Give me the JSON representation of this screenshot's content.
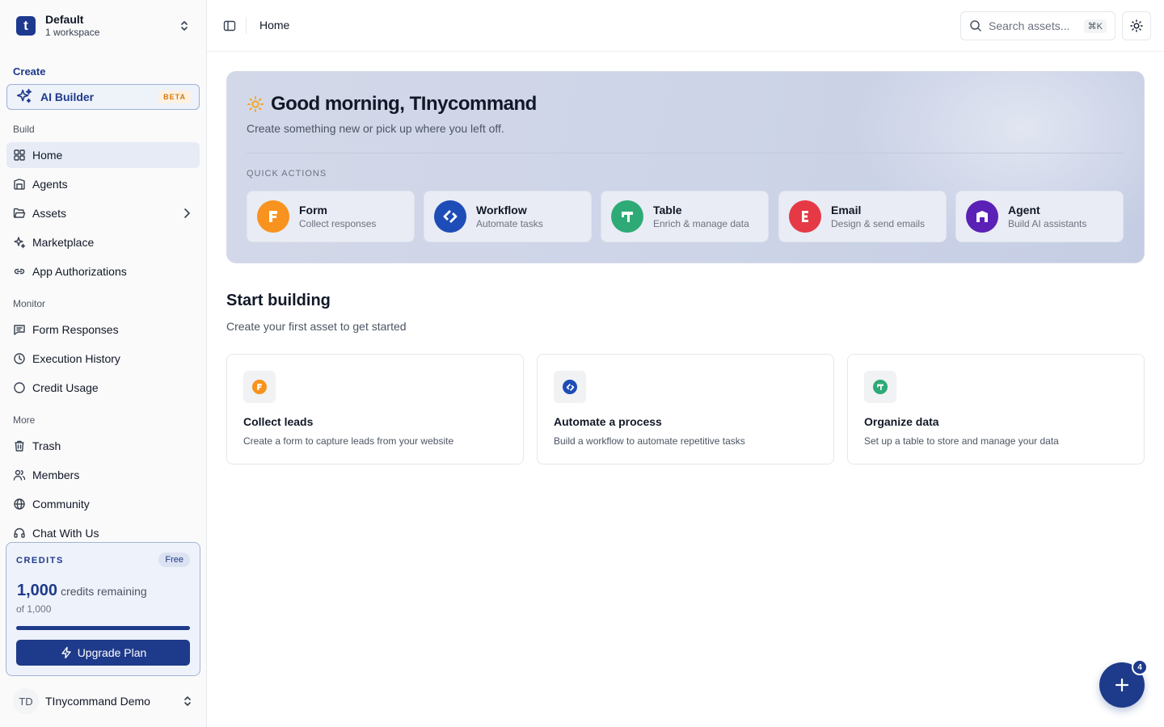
{
  "workspace": {
    "name": "Default",
    "sub": "1 workspace",
    "logo_letter": "t"
  },
  "sidebar": {
    "create_label": "Create",
    "ai_builder": {
      "label": "AI Builder",
      "badge": "BETA"
    },
    "build_label": "Build",
    "build_items": [
      {
        "label": "Home",
        "icon": "grid-icon"
      },
      {
        "label": "Agents",
        "icon": "agent-icon"
      },
      {
        "label": "Assets",
        "icon": "folder-icon"
      },
      {
        "label": "Marketplace",
        "icon": "sparkle-icon"
      },
      {
        "label": "App Authorizations",
        "icon": "link-icon"
      }
    ],
    "monitor_label": "Monitor",
    "monitor_items": [
      {
        "label": "Form Responses",
        "icon": "message-icon"
      },
      {
        "label": "Execution History",
        "icon": "clock-icon"
      },
      {
        "label": "Credit Usage",
        "icon": "circle-icon"
      }
    ],
    "more_label": "More",
    "more_items": [
      {
        "label": "Trash",
        "icon": "trash-icon"
      },
      {
        "label": "Members",
        "icon": "users-icon"
      },
      {
        "label": "Community",
        "icon": "globe-icon"
      },
      {
        "label": "Chat With Us",
        "icon": "headset-icon"
      }
    ]
  },
  "credits": {
    "header": "CREDITS",
    "plan": "Free",
    "remaining": "1,000",
    "remaining_label": "credits remaining",
    "total": "of 1,000",
    "fraction_remaining": 1.0,
    "upgrade_label": "Upgrade Plan"
  },
  "user": {
    "initials": "TD",
    "name": "TInycommand Demo"
  },
  "topbar": {
    "breadcrumb": "Home",
    "search_placeholder": "Search assets...",
    "shortcut": "⌘K"
  },
  "hero": {
    "greeting": "Good morning, TInycommand",
    "subtitle": "Create something new or pick up where you left off.",
    "quick_actions_label": "QUICK ACTIONS",
    "quick_actions": [
      {
        "title": "Form",
        "sub": "Collect responses",
        "color": "#f7931e"
      },
      {
        "title": "Workflow",
        "sub": "Automate tasks",
        "color": "#1e4db7"
      },
      {
        "title": "Table",
        "sub": "Enrich & manage data",
        "color": "#2eaa76"
      },
      {
        "title": "Email",
        "sub": "Design & send emails",
        "color": "#e53945"
      },
      {
        "title": "Agent",
        "sub": "Build AI assistants",
        "color": "#5b21b6"
      }
    ]
  },
  "start_building": {
    "title": "Start building",
    "subtitle": "Create your first asset to get started",
    "cards": [
      {
        "title": "Collect leads",
        "sub": "Create a form to capture leads from your website",
        "color": "#f7931e"
      },
      {
        "title": "Automate a process",
        "sub": "Build a workflow to automate repetitive tasks",
        "color": "#1e4db7"
      },
      {
        "title": "Organize data",
        "sub": "Set up a table to store and manage your data",
        "color": "#2eaa76"
      }
    ]
  },
  "fab": {
    "badge": "4"
  },
  "colors": {
    "accent": "#1e3a8a",
    "active_bg": "#e6ebf5",
    "beta": "#d97706"
  }
}
